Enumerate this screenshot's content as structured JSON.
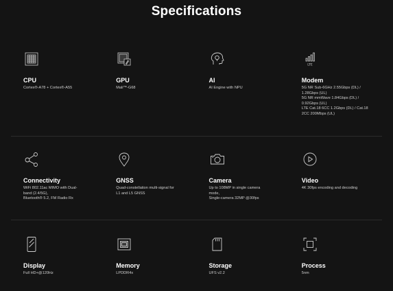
{
  "page": {
    "title": "Specifications"
  },
  "specs": [
    {
      "name": "CPU",
      "desc": "Cortex®-A78 + Cortex®-A55",
      "icon": "cpu-chip-icon"
    },
    {
      "name": "GPU",
      "desc": "Mali™-G68",
      "icon": "gpu-icon"
    },
    {
      "name": "AI",
      "desc": "AI Engine with NPU",
      "icon": "ai-brain-icon"
    },
    {
      "name": "Modem",
      "desc": "5G NR Sub-6GHz 2.55Gbps (DL) /\n1.28Gbps (UL)\n5G NR mmWave 1.84Gbps (DL) /\n0.92Gbps (UL)\nLTE Cat.18 6CC 1.2Gbps (DL) / Cat.18\n2CC 200Mbps (UL)",
      "icon": "lte-signal-icon"
    },
    {
      "name": "Connectivity",
      "desc": "WiFi 802.11ac MIMO with Dual-\nband (2.4/5G),\nBluetooth® 5.2, FM Radio Rx",
      "icon": "share-nodes-icon"
    },
    {
      "name": "GNSS",
      "desc": "Quad-constellation multi-signal for\nL1 and L5 GNSS",
      "icon": "location-pin-icon"
    },
    {
      "name": "Camera",
      "desc": "Up to 108MP in single camera\nmode,\nSingle-camera 32MP @30fps",
      "icon": "camera-icon"
    },
    {
      "name": "Video",
      "desc": "4K 30fps encoding and decoding",
      "icon": "play-circle-icon"
    },
    {
      "name": "Display",
      "desc": "Full HD+@120Hz",
      "icon": "phone-display-icon"
    },
    {
      "name": "Memory",
      "desc": "LPDDR4x",
      "icon": "memory-chip-icon"
    },
    {
      "name": "Storage",
      "desc": "UFS v2.2",
      "icon": "sd-card-icon"
    },
    {
      "name": "Process",
      "desc": "5nm",
      "icon": "process-icon"
    }
  ],
  "colors": {
    "background": "#141414",
    "divider": "#2c2c2c",
    "icon_stroke": "#cfcfcf",
    "text_primary": "#ffffff",
    "text_secondary": "#cfcfcf"
  }
}
